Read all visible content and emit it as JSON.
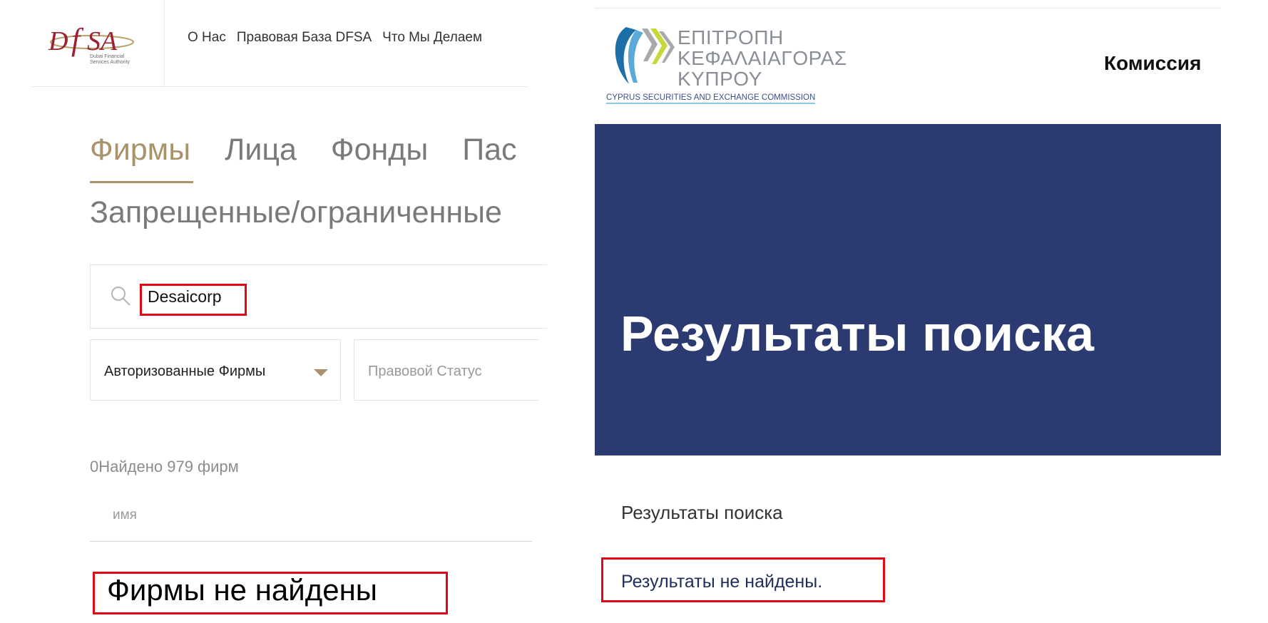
{
  "dfsa": {
    "logo": {
      "line1": "Dubai Financial",
      "line2": "Services Authority"
    },
    "nav": [
      "О Нас",
      "Правовая База DFSA",
      "Что Мы Делаем"
    ],
    "tabs": [
      "Фирмы",
      "Лица",
      "Фонды",
      "Пас"
    ],
    "subtab": "Запрещенные/ограниченные",
    "search": {
      "value": "Desaicorp"
    },
    "dropdown": {
      "selected": "Авторизованные Фирмы"
    },
    "status_placeholder": "Правовой Статус",
    "found_text": "0Найдено 979 фирм",
    "table_header_name": "имя",
    "no_results": "Фирмы не найдены",
    "accent_color": "#a8936a"
  },
  "cysec": {
    "logo": {
      "greek_line1": "ΕΠΙΤΡΟΠΗ",
      "greek_line2": "ΚΕΦΑΛΑΙΑΓΟΡΑΣ",
      "greek_line3": "ΚΥΠΡΟΥ",
      "english": "CYPRUS SECURITIES AND EXCHANGE COMMISSION"
    },
    "nav_item": "Комиссия",
    "banner_title": "Результаты поиска",
    "section_title": "Результаты поиска",
    "no_results": "Результаты не найдены.",
    "banner_color": "#2b3a70"
  },
  "highlight_color": "#e30613"
}
